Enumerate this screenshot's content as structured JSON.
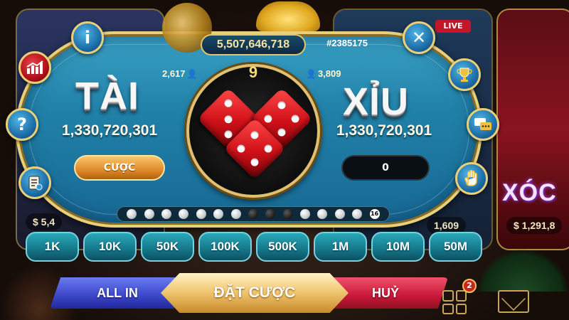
{
  "background": {
    "live_badge": "LIVE",
    "xoc_label": "XÓC",
    "left_amount": "$ 5,4",
    "mid_amount": "1,609",
    "right_amount": "$ 1,291,8"
  },
  "header": {
    "jackpot": "5,507,646,718",
    "session_id": "#2385175"
  },
  "tai": {
    "title": "TÀI",
    "total": "1,330,720,301",
    "players": "2,617",
    "bet_label": "CƯỢC"
  },
  "xiu": {
    "title": "XỈU",
    "total": "1,330,720,301",
    "players": "3,809",
    "bet_value": "0"
  },
  "round": {
    "countdown": "9",
    "dice": [
      3,
      4,
      4
    ]
  },
  "history": {
    "results": [
      "w",
      "w",
      "w",
      "w",
      "w",
      "w",
      "w",
      "b",
      "b",
      "b",
      "w",
      "w",
      "w",
      "w"
    ],
    "count": "16"
  },
  "chips": [
    "1K",
    "10K",
    "50K",
    "100K",
    "500K",
    "1M",
    "10M",
    "50M"
  ],
  "actions": {
    "all_in": "ALL IN",
    "place_bet": "ĐẶT CƯỢC",
    "cancel": "HUỶ"
  },
  "notifications": {
    "count": "2"
  },
  "icons": {
    "info": "info-icon",
    "close": "close-icon",
    "stats": "chart-icon",
    "help": "question-icon",
    "rules": "scroll-icon",
    "trophy": "trophy-icon",
    "chat": "chat-icon",
    "hand": "hand-icon"
  },
  "colors": {
    "table": "#2181a8",
    "gold": "#e8cf7a",
    "dice": "#d01018",
    "allin": "#3a46c8",
    "cancel": "#c8183a",
    "place_bet": "#f2c874"
  }
}
